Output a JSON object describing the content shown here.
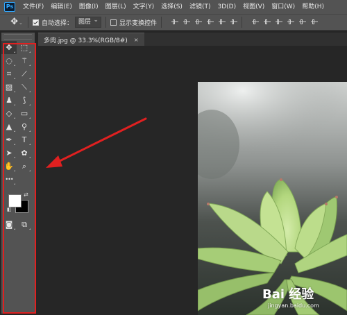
{
  "app": {
    "logo": "Ps",
    "menu": [
      "文件(F)",
      "编辑(E)",
      "图像(I)",
      "图层(L)",
      "文字(Y)",
      "选择(S)",
      "滤镜(T)",
      "3D(D)",
      "视图(V)",
      "窗口(W)",
      "帮助(H)"
    ]
  },
  "options": {
    "auto_select_label": "自动选择：",
    "auto_select_checked": true,
    "layer_select_value": "图层",
    "show_transform_label": "显示变换控件",
    "show_transform_checked": false
  },
  "document": {
    "tab_title": "多肉.jpg @ 33.3%(RGB/8#)",
    "close_glyph": "×"
  },
  "toolbar": {
    "tools": [
      [
        "move-icon",
        "rect-marquee-icon"
      ],
      [
        "lasso-icon",
        "magic-wand-icon"
      ],
      [
        "crop-icon",
        "eyedropper-icon"
      ],
      [
        "healing-brush-icon",
        "brush-icon"
      ],
      [
        "clone-stamp-icon",
        "history-brush-icon"
      ],
      [
        "eraser-icon",
        "gradient-icon"
      ],
      [
        "blur-icon",
        "dodge-icon"
      ],
      [
        "pen-icon",
        "type-icon"
      ],
      [
        "path-select-icon",
        "custom-shape-icon"
      ],
      [
        "hand-icon",
        "zoom-icon"
      ],
      [
        "more-tools-icon"
      ]
    ],
    "glyphs": {
      "move-icon": "✥",
      "rect-marquee-icon": "⬚",
      "lasso-icon": "◌",
      "magic-wand-icon": "⚚",
      "crop-icon": "⌗",
      "eyedropper-icon": "⟋",
      "healing-brush-icon": "▨",
      "brush-icon": "⟍",
      "clone-stamp-icon": "♟",
      "history-brush-icon": "⟆",
      "eraser-icon": "◇",
      "gradient-icon": "▭",
      "blur-icon": "▲",
      "dodge-icon": "⚲",
      "pen-icon": "✒",
      "type-icon": "T",
      "path-select-icon": "➤",
      "custom-shape-icon": "✿",
      "hand-icon": "✋",
      "zoom-icon": "⌕",
      "more-tools-icon": "•••"
    },
    "foreground_color": "#ffffff",
    "background_color": "#000000"
  },
  "watermark": {
    "brand": "Bai 经验",
    "url": "jingyan.baidu.com"
  },
  "colors": {
    "highlight": "#e02020",
    "ps_blue": "#31a8ff"
  }
}
